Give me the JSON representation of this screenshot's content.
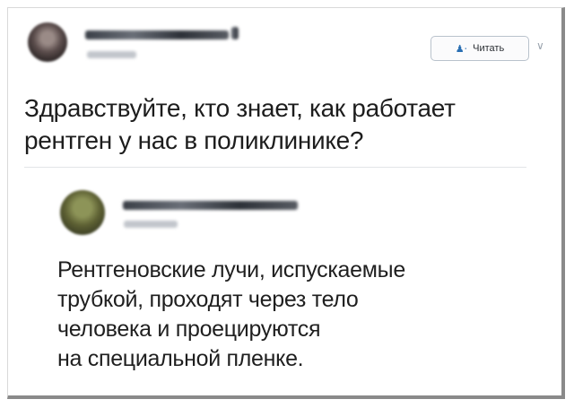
{
  "post": {
    "author_name": "",
    "author_handle": "",
    "follow_label": "Читать",
    "lines": [
      "Здравствуйте, кто знает, как работает",
      "рентген у нас в поликлинике?"
    ]
  },
  "reply": {
    "author_name": "",
    "author_handle": "",
    "lines": [
      "Рентгеновские лучи, испускаемые",
      "трубкой, проходят через тело",
      "человека и проецируются",
      "на специальной пленке."
    ]
  },
  "icons": {
    "follow": "add-user-icon",
    "menu": "chevron-down-icon"
  },
  "colors": {
    "text": "#1d1d1d",
    "accent": "#2a6fb3",
    "border": "#b9c2cc"
  }
}
